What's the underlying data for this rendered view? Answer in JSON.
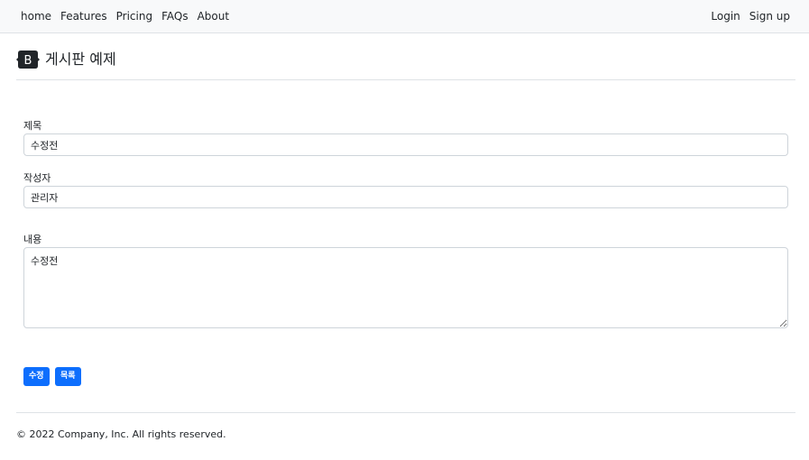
{
  "nav": {
    "links": [
      "home",
      "Features",
      "Pricing",
      "FAQs",
      "About"
    ],
    "login": "Login",
    "signup": "Sign up"
  },
  "brand": {
    "logo_letter": "B",
    "title": "게시판 예제"
  },
  "form": {
    "title_label": "제목",
    "title_value": "수정전",
    "author_label": "작성자",
    "author_value": "관리자",
    "content_label": "내용",
    "content_value": "수정전"
  },
  "buttons": {
    "edit": "수정",
    "list": "목록"
  },
  "footer": {
    "text": "© 2022 Company, Inc. All rights reserved."
  },
  "colors": {
    "primary": "#0d6efd",
    "nav_bg": "#f8f9fa",
    "logo_bg": "#212529"
  }
}
